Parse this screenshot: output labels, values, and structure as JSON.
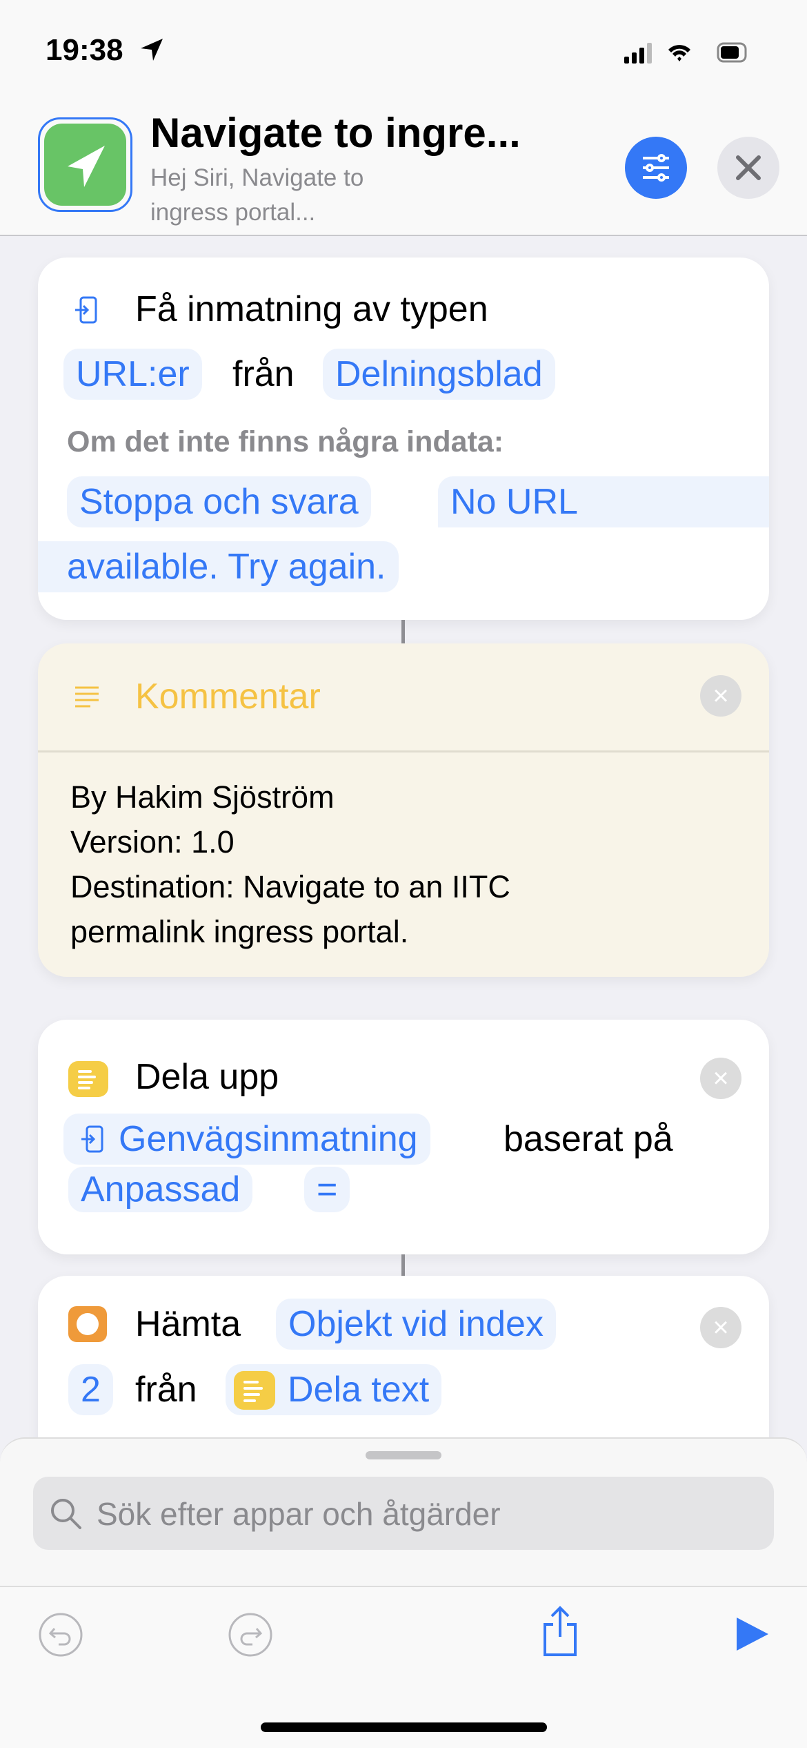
{
  "status": {
    "time": "19:38"
  },
  "header": {
    "title": "Navigate to ingre...",
    "subtitle_line1": "Hej Siri, Navigate to",
    "subtitle_line2": "ingress portal..."
  },
  "actions": [
    {
      "title": "Få inmatning av typen",
      "type": "URL:er",
      "from": "från",
      "source": "Delningsblad",
      "no_input_label": "Om det inte finns några indata:",
      "behavior": "Stoppa och svara",
      "message_line1": "No URL",
      "message_line2": "available. Try again."
    },
    {
      "title": "Kommentar",
      "lines": [
        "By Hakim Sjöström",
        "Version: 1.0",
        "Destination:  Navigate to an IITC",
        "permalink ingress portal."
      ]
    },
    {
      "title": "Dela upp",
      "input": "Genvägsinmatning",
      "based_on": "baserat på",
      "separator_type": "Anpassad",
      "separator": "="
    },
    {
      "title": "Hämta",
      "item": "Objekt vid index",
      "index": "2",
      "from": "från",
      "source": "Dela text"
    }
  ],
  "search": {
    "placeholder": "Sök efter appar och åtgärder"
  },
  "colors": {
    "accent": "#3478f6",
    "app_icon": "#68c466",
    "comment_bg": "#f8f4e8",
    "comment_title": "#f5c243",
    "orange": "#ef9a3a"
  }
}
